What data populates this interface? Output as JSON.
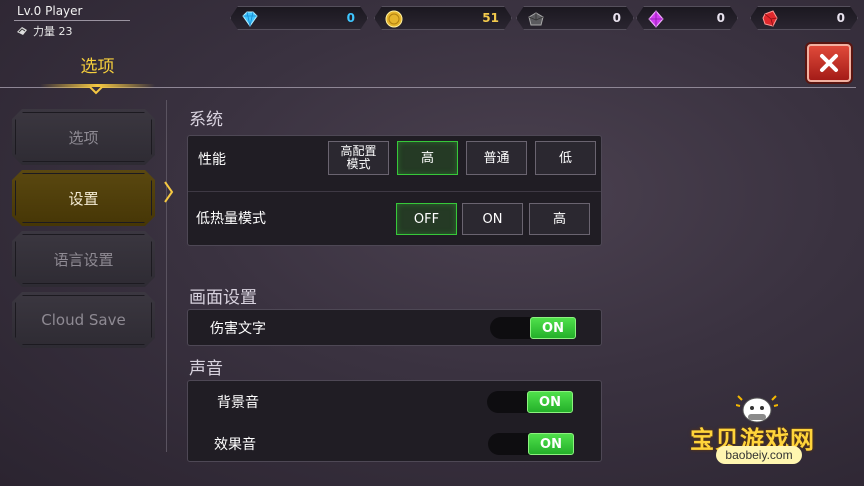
{
  "player": {
    "name": "Lv.0 Player",
    "power": "力量 23"
  },
  "currencies": [
    {
      "icon": "diamond-icon",
      "value": "0",
      "color": "#3ec6ff"
    },
    {
      "icon": "gold-coin-icon",
      "value": "51",
      "color": "#f2c94c"
    },
    {
      "icon": "ore-icon",
      "value": "0",
      "color": "#ffffff"
    },
    {
      "icon": "purple-gem-icon",
      "value": "0",
      "color": "#ffffff"
    },
    {
      "icon": "red-crystal-icon",
      "value": "0",
      "color": "#ffffff"
    }
  ],
  "header": {
    "title": "选项"
  },
  "sidebar": {
    "items": [
      {
        "label": "选项"
      },
      {
        "label": "设置",
        "active": true
      },
      {
        "label": "语言设置"
      },
      {
        "label": "Cloud Save"
      }
    ]
  },
  "system": {
    "title": "系统",
    "performance": {
      "label": "性能",
      "options": [
        "高配置\n模式",
        "高",
        "普通",
        "低"
      ],
      "selected": "高"
    },
    "low_heat": {
      "label": "低热量模式",
      "options": [
        "OFF",
        "ON",
        "高"
      ],
      "selected": "OFF"
    }
  },
  "display": {
    "title": "画面设置",
    "damage_text": {
      "label": "伤害文字",
      "state": "ON"
    }
  },
  "sound": {
    "title": "声音",
    "bgm": {
      "label": "背景音",
      "state": "ON"
    },
    "sfx": {
      "label": "效果音",
      "state": "ON"
    }
  },
  "watermark": {
    "text": "宝贝游戏网",
    "url": "baobeiy.com"
  },
  "colors": {
    "accent_gold": "#f6cf3c",
    "toggle_green": "#37c83a",
    "close_red": "#c8302a"
  }
}
